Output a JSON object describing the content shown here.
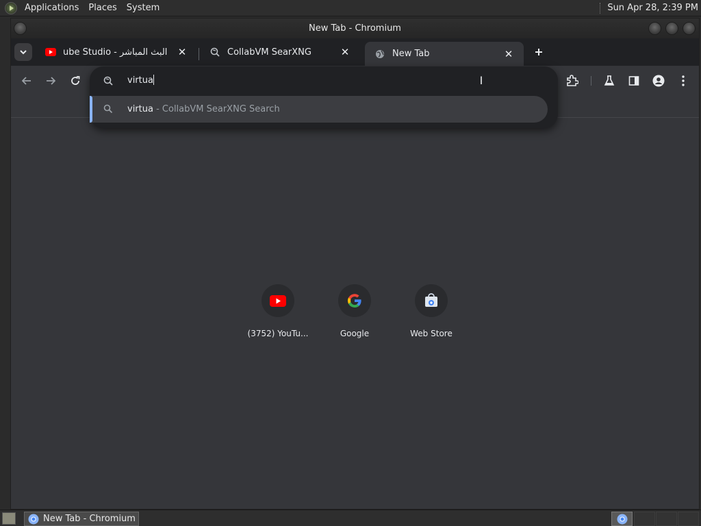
{
  "top_panel": {
    "menus": [
      "Applications",
      "Places",
      "System"
    ],
    "clock": "Sun Apr 28,  2:39 PM"
  },
  "window": {
    "title": "New Tab - Chromium"
  },
  "tabs": [
    {
      "title": "‏البث المباشر - YouTube Studio",
      "display": "ube Studio - البث المباشر",
      "favicon": "youtube-icon"
    },
    {
      "title": "CollabVM SearXNG",
      "display": "CollabVM SearXNG",
      "favicon": "searxng-icon"
    },
    {
      "title": "New Tab",
      "display": "New Tab",
      "favicon": "globe-icon",
      "active": true
    }
  ],
  "omnibox": {
    "typed_text": "virtua",
    "suggestion": {
      "query": "virtua",
      "provider": " - CollabVM SearXNG Search"
    }
  },
  "shortcuts": [
    {
      "label": "(3752) YouTu...",
      "icon": "youtube-icon"
    },
    {
      "label": "Google",
      "icon": "google-icon"
    },
    {
      "label": "Web Store",
      "icon": "web-store-icon"
    }
  ],
  "taskbar": {
    "window_button": "New Tab - Chromium"
  },
  "colors": {
    "accent": "#8ab4f8",
    "toolbar_bg": "#35363a",
    "tabstrip_bg": "#202124"
  }
}
